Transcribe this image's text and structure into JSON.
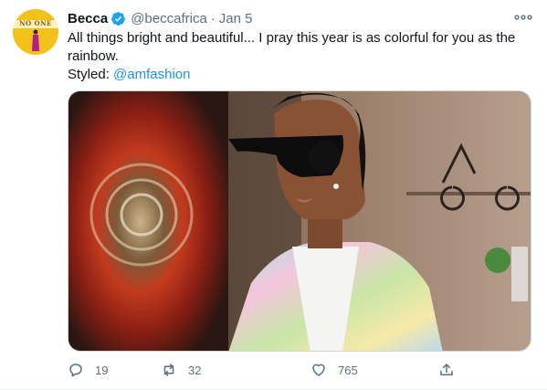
{
  "tweet": {
    "author_name": "Becca",
    "handle": "@beccafrica",
    "separator": "·",
    "date": "Jan 5",
    "verified": true,
    "text_line1": "All things bright and beautiful... I pray this year is as colorful for you as the",
    "text_line2": "rainbow.",
    "styled_prefix": "Styled: ",
    "styled_mention": "@amfashion",
    "avatar_text": "NO ONE"
  },
  "actions": {
    "reply_count": "19",
    "retweet_count": "32",
    "like_count": "765"
  },
  "colors": {
    "accent": "#1da1f2",
    "mention": "#1b95e0",
    "secondary_text": "#5b7083",
    "primary_text": "#0f1419"
  },
  "icons": {
    "more": "more-horizontal-icon",
    "reply": "comment-bubble-icon",
    "retweet": "retweet-arrows-icon",
    "like": "heart-outline-icon",
    "share": "share-upload-icon",
    "verified": "verified-badge-icon"
  }
}
